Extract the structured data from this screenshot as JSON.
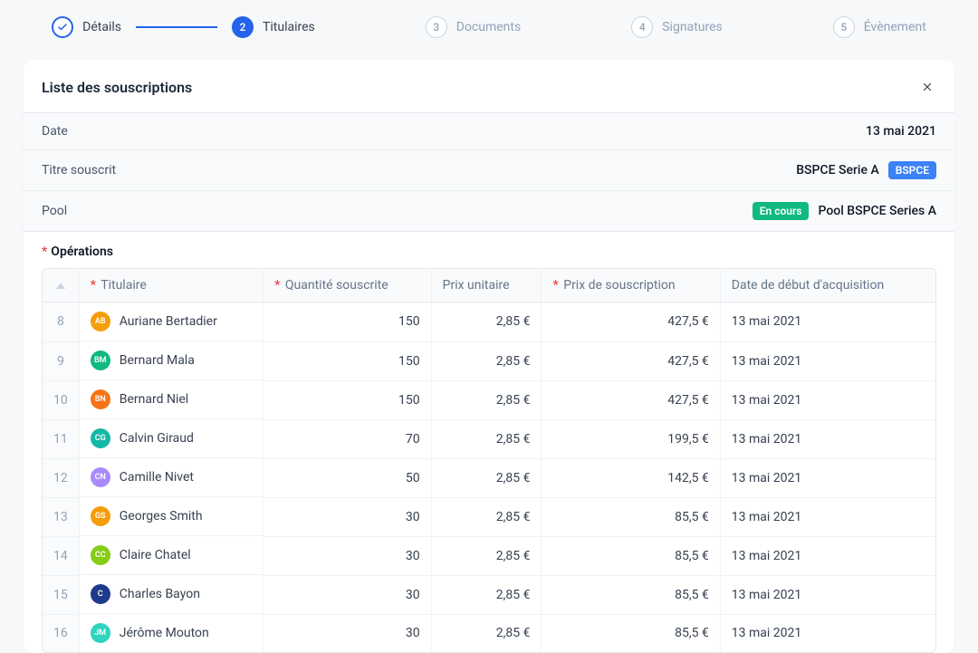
{
  "stepper": {
    "steps": [
      {
        "num": "",
        "label": "Détails",
        "state": "done"
      },
      {
        "num": "2",
        "label": "Titulaires",
        "state": "active"
      },
      {
        "num": "3",
        "label": "Documents",
        "state": "pending"
      },
      {
        "num": "4",
        "label": "Signatures",
        "state": "pending"
      },
      {
        "num": "5",
        "label": "Évènement",
        "state": "pending"
      }
    ]
  },
  "panel": {
    "title": "Liste des souscriptions"
  },
  "info": {
    "date_label": "Date",
    "date_value": "13 mai 2021",
    "titre_label": "Titre souscrit",
    "titre_value": "BSPCE Serie A",
    "titre_badge": "BSPCE",
    "pool_label": "Pool",
    "pool_badge": "En cours",
    "pool_value": "Pool BSPCE Series A"
  },
  "operations": {
    "section_label": "Opérations",
    "columns": {
      "holder": "Titulaire",
      "qty": "Quantité souscrite",
      "unit_price": "Prix unitaire",
      "sub_price": "Prix de souscription",
      "acq_date": "Date de début d'acquisition"
    },
    "rows": [
      {
        "idx": "8",
        "initials": "AB",
        "color": "#f59e0b",
        "name": "Auriane Bertadier",
        "qty": "150",
        "unit": "2,85 €",
        "sub": "427,5 €",
        "date": "13 mai 2021"
      },
      {
        "idx": "9",
        "initials": "BM",
        "color": "#10b981",
        "name": "Bernard Mala",
        "qty": "150",
        "unit": "2,85 €",
        "sub": "427,5 €",
        "date": "13 mai 2021"
      },
      {
        "idx": "10",
        "initials": "BN",
        "color": "#f97316",
        "name": "Bernard Niel",
        "qty": "150",
        "unit": "2,85 €",
        "sub": "427,5 €",
        "date": "13 mai 2021"
      },
      {
        "idx": "11",
        "initials": "CG",
        "color": "#14b8a6",
        "name": "Calvin Giraud",
        "qty": "70",
        "unit": "2,85 €",
        "sub": "199,5 €",
        "date": "13 mai 2021"
      },
      {
        "idx": "12",
        "initials": "CN",
        "color": "#a78bfa",
        "name": "Camille Nivet",
        "qty": "50",
        "unit": "2,85 €",
        "sub": "142,5 €",
        "date": "13 mai 2021"
      },
      {
        "idx": "13",
        "initials": "GS",
        "color": "#f59e0b",
        "name": "Georges Smith",
        "qty": "30",
        "unit": "2,85 €",
        "sub": "85,5 €",
        "date": "13 mai 2021"
      },
      {
        "idx": "14",
        "initials": "CC",
        "color": "#84cc16",
        "name": "Claire Chatel",
        "qty": "30",
        "unit": "2,85 €",
        "sub": "85,5 €",
        "date": "13 mai 2021"
      },
      {
        "idx": "15",
        "initials": "C",
        "color": "#1e3a8a",
        "name": "Charles Bayon",
        "qty": "30",
        "unit": "2,85 €",
        "sub": "85,5 €",
        "date": "13 mai 2021"
      },
      {
        "idx": "16",
        "initials": "JM",
        "color": "#2dd4bf",
        "name": "Jérôme Mouton",
        "qty": "30",
        "unit": "2,85 €",
        "sub": "85,5 €",
        "date": "13 mai 2021"
      }
    ]
  }
}
